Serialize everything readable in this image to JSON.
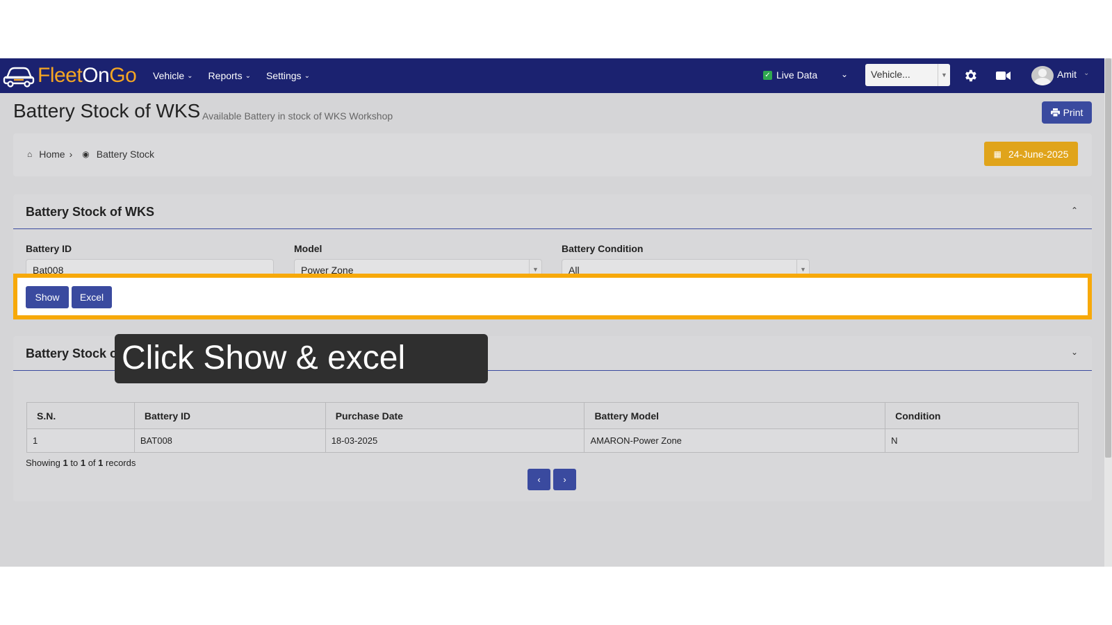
{
  "navbar": {
    "logo": {
      "part1": "Fleet",
      "part2": "On",
      "part3": "Go"
    },
    "menu": [
      {
        "label": "Vehicle"
      },
      {
        "label": "Reports"
      },
      {
        "label": "Settings"
      }
    ],
    "live_data_label": "Live Data",
    "vehicle_select": "Vehicle...",
    "user_name": "Amit"
  },
  "header": {
    "title": "Battery Stock of WKS",
    "subtitle": "Available Battery in stock of WKS Workshop",
    "print_label": "Print"
  },
  "breadcrumb": {
    "home": "Home",
    "current": "Battery Stock",
    "date": "24-June-2025"
  },
  "filter_panel": {
    "title": "Battery Stock of WKS",
    "battery_id_label": "Battery ID",
    "battery_id_value": "Bat008",
    "model_label": "Model",
    "model_value": "Power Zone",
    "condition_label": "Battery Condition",
    "condition_value": "All",
    "show_label": "Show",
    "excel_label": "Excel"
  },
  "results_panel": {
    "title": "Battery Stock of WKS",
    "columns": [
      "S.N.",
      "Battery ID",
      "Purchase Date",
      "Battery Model",
      "Condition"
    ],
    "rows": [
      [
        "1",
        "BAT008",
        "18-03-2025",
        "AMARON-Power Zone",
        "N"
      ]
    ],
    "showing": {
      "prefix": "Showing",
      "from": "1",
      "to_word": "to",
      "to": "1",
      "of_word": "of",
      "total": "1",
      "suffix": "records"
    },
    "prev_label": "‹",
    "next_label": "›"
  },
  "tooltip": {
    "text": "Click Show & excel"
  },
  "colors": {
    "navbar": "#1b2270",
    "primary_button": "#3a4a9f",
    "highlight": "#f7a90a",
    "date_badge": "#e0a41b",
    "logo_accent": "#f5a623"
  }
}
